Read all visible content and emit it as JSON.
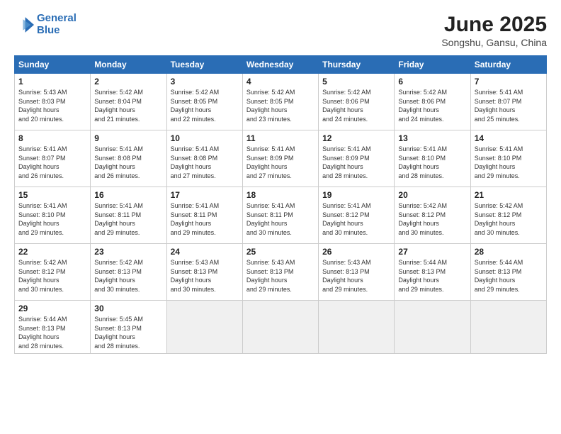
{
  "logo": {
    "line1": "General",
    "line2": "Blue"
  },
  "title": "June 2025",
  "subtitle": "Songshu, Gansu, China",
  "days_header": [
    "Sunday",
    "Monday",
    "Tuesday",
    "Wednesday",
    "Thursday",
    "Friday",
    "Saturday"
  ],
  "weeks": [
    [
      {
        "day": "1",
        "sunrise": "5:43 AM",
        "sunset": "8:03 PM",
        "daylight": "14 hours and 20 minutes."
      },
      {
        "day": "2",
        "sunrise": "5:42 AM",
        "sunset": "8:04 PM",
        "daylight": "14 hours and 21 minutes."
      },
      {
        "day": "3",
        "sunrise": "5:42 AM",
        "sunset": "8:05 PM",
        "daylight": "14 hours and 22 minutes."
      },
      {
        "day": "4",
        "sunrise": "5:42 AM",
        "sunset": "8:05 PM",
        "daylight": "14 hours and 23 minutes."
      },
      {
        "day": "5",
        "sunrise": "5:42 AM",
        "sunset": "8:06 PM",
        "daylight": "14 hours and 24 minutes."
      },
      {
        "day": "6",
        "sunrise": "5:42 AM",
        "sunset": "8:06 PM",
        "daylight": "14 hours and 24 minutes."
      },
      {
        "day": "7",
        "sunrise": "5:41 AM",
        "sunset": "8:07 PM",
        "daylight": "14 hours and 25 minutes."
      }
    ],
    [
      {
        "day": "8",
        "sunrise": "5:41 AM",
        "sunset": "8:07 PM",
        "daylight": "14 hours and 26 minutes."
      },
      {
        "day": "9",
        "sunrise": "5:41 AM",
        "sunset": "8:08 PM",
        "daylight": "14 hours and 26 minutes."
      },
      {
        "day": "10",
        "sunrise": "5:41 AM",
        "sunset": "8:08 PM",
        "daylight": "14 hours and 27 minutes."
      },
      {
        "day": "11",
        "sunrise": "5:41 AM",
        "sunset": "8:09 PM",
        "daylight": "14 hours and 27 minutes."
      },
      {
        "day": "12",
        "sunrise": "5:41 AM",
        "sunset": "8:09 PM",
        "daylight": "14 hours and 28 minutes."
      },
      {
        "day": "13",
        "sunrise": "5:41 AM",
        "sunset": "8:10 PM",
        "daylight": "14 hours and 28 minutes."
      },
      {
        "day": "14",
        "sunrise": "5:41 AM",
        "sunset": "8:10 PM",
        "daylight": "14 hours and 29 minutes."
      }
    ],
    [
      {
        "day": "15",
        "sunrise": "5:41 AM",
        "sunset": "8:10 PM",
        "daylight": "14 hours and 29 minutes."
      },
      {
        "day": "16",
        "sunrise": "5:41 AM",
        "sunset": "8:11 PM",
        "daylight": "14 hours and 29 minutes."
      },
      {
        "day": "17",
        "sunrise": "5:41 AM",
        "sunset": "8:11 PM",
        "daylight": "14 hours and 29 minutes."
      },
      {
        "day": "18",
        "sunrise": "5:41 AM",
        "sunset": "8:11 PM",
        "daylight": "14 hours and 30 minutes."
      },
      {
        "day": "19",
        "sunrise": "5:41 AM",
        "sunset": "8:12 PM",
        "daylight": "14 hours and 30 minutes."
      },
      {
        "day": "20",
        "sunrise": "5:42 AM",
        "sunset": "8:12 PM",
        "daylight": "14 hours and 30 minutes."
      },
      {
        "day": "21",
        "sunrise": "5:42 AM",
        "sunset": "8:12 PM",
        "daylight": "14 hours and 30 minutes."
      }
    ],
    [
      {
        "day": "22",
        "sunrise": "5:42 AM",
        "sunset": "8:12 PM",
        "daylight": "14 hours and 30 minutes."
      },
      {
        "day": "23",
        "sunrise": "5:42 AM",
        "sunset": "8:13 PM",
        "daylight": "14 hours and 30 minutes."
      },
      {
        "day": "24",
        "sunrise": "5:43 AM",
        "sunset": "8:13 PM",
        "daylight": "14 hours and 30 minutes."
      },
      {
        "day": "25",
        "sunrise": "5:43 AM",
        "sunset": "8:13 PM",
        "daylight": "14 hours and 29 minutes."
      },
      {
        "day": "26",
        "sunrise": "5:43 AM",
        "sunset": "8:13 PM",
        "daylight": "14 hours and 29 minutes."
      },
      {
        "day": "27",
        "sunrise": "5:44 AM",
        "sunset": "8:13 PM",
        "daylight": "14 hours and 29 minutes."
      },
      {
        "day": "28",
        "sunrise": "5:44 AM",
        "sunset": "8:13 PM",
        "daylight": "14 hours and 29 minutes."
      }
    ],
    [
      {
        "day": "29",
        "sunrise": "5:44 AM",
        "sunset": "8:13 PM",
        "daylight": "14 hours and 28 minutes."
      },
      {
        "day": "30",
        "sunrise": "5:45 AM",
        "sunset": "8:13 PM",
        "daylight": "14 hours and 28 minutes."
      },
      null,
      null,
      null,
      null,
      null
    ]
  ]
}
